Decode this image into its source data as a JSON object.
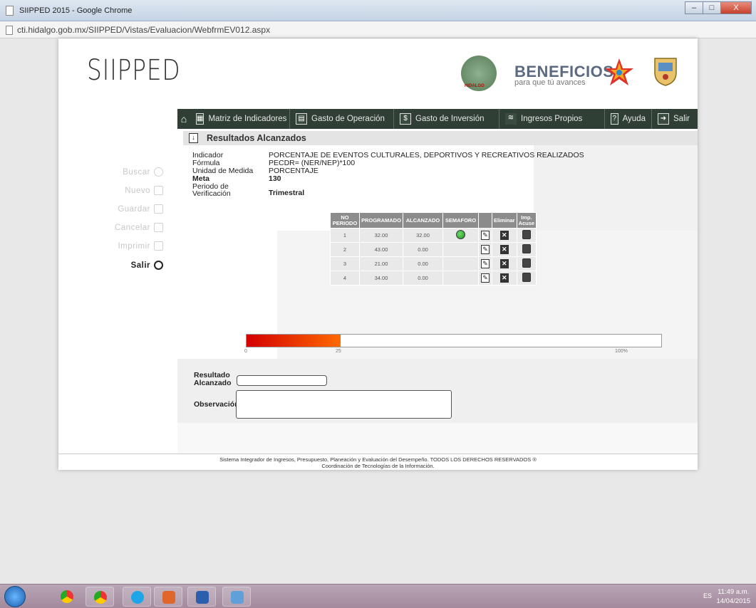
{
  "window": {
    "title": "SIIPPED 2015 - Google Chrome",
    "url": "cti.hidalgo.gob.mx/SIIPPED/Vistas/Evaluacion/WebfrmEV012.aspx",
    "buttons": {
      "minimize": "–",
      "maximize": "□",
      "close": "X"
    }
  },
  "header": {
    "logo": "SIIPPED",
    "seal_label": "HIDALGO",
    "benef_title": "BENEFICIOS",
    "benef_sub": "para que tú avances"
  },
  "nav": {
    "items": [
      {
        "label": "Matriz de Indicadores",
        "icon": "grid-icon"
      },
      {
        "label": "Gasto de Operación",
        "icon": "calculator-icon"
      },
      {
        "label": "Gasto de Inversión",
        "icon": "dollar-icon"
      },
      {
        "label": "Ingresos Propios",
        "icon": "coins-icon"
      },
      {
        "label": "Ayuda",
        "icon": "help-icon"
      },
      {
        "label": "Salir",
        "icon": "exit-icon"
      }
    ]
  },
  "sidebar": {
    "items": [
      {
        "label": "Buscar"
      },
      {
        "label": "Nuevo"
      },
      {
        "label": "Guardar"
      },
      {
        "label": "Cancelar"
      },
      {
        "label": "Imprimir"
      },
      {
        "label": "Salir"
      }
    ]
  },
  "section": {
    "title": "Resultados Alcanzados"
  },
  "info": {
    "indicador_label": "Indicador",
    "indicador": "PORCENTAJE DE EVENTOS CULTURALES, DEPORTIVOS Y RECREATIVOS REALIZADOS",
    "formula_label": "Fórmula",
    "formula": "PECDR= (NER/NEP)*100",
    "unidad_label": "Unidad de Medida",
    "unidad": "PORCENTAJE",
    "meta_label": "Meta",
    "meta": "130",
    "periodo_label": "Periodo de Verificación",
    "periodo": "Trimestral"
  },
  "table": {
    "headers": [
      "NO PERIODO",
      "PROGRAMADO",
      "ALCANZADO",
      "SEMAFORO",
      "",
      "Eliminar",
      "Imp. Acuse"
    ],
    "rows": [
      {
        "periodo": "1",
        "programado": "32.00",
        "alcanzado": "32.00",
        "semaforo": true
      },
      {
        "periodo": "2",
        "programado": "43.00",
        "alcanzado": "0.00",
        "semaforo": false
      },
      {
        "periodo": "3",
        "programado": "21.00",
        "alcanzado": "0.00",
        "semaforo": false
      },
      {
        "periodo": "4",
        "programado": "34.00",
        "alcanzado": "0.00",
        "semaforo": false
      }
    ]
  },
  "progress": {
    "value_fraction": 0.227,
    "tick_start": "0",
    "tick_mid": "25",
    "tick_end": "100%"
  },
  "form": {
    "resultado_label": "Resultado Alcanzado",
    "resultado_value": "",
    "observacion_label": "Observación",
    "observacion_value": ""
  },
  "footer": {
    "line1": "Sistema Integrador de Ingresos, Presupuesto, Planeación y Evaluación del Desempeño. TODOS LOS DERECHOS RESERVADOS ®",
    "line2": "Coordinación de Tecnologías de la Información."
  },
  "taskbar": {
    "lang": "ES",
    "time": "11:49 a.m.",
    "date": "14/04/2015"
  }
}
